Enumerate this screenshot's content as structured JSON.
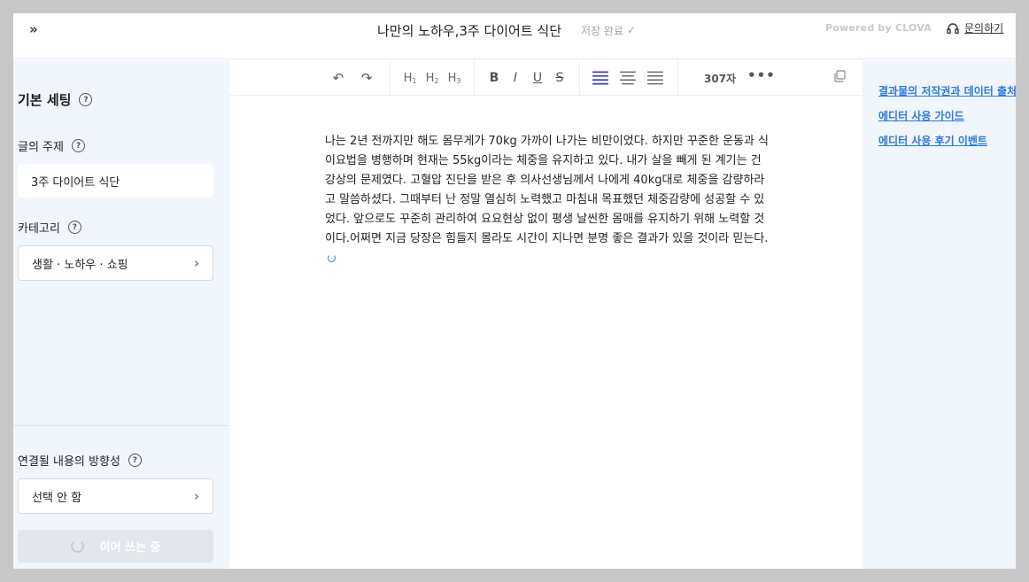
{
  "header": {
    "expand_icon": "double-chevron-right-icon",
    "expand_glyph": "»",
    "title": "나만의 노하우,3주 다이어트 식단",
    "save_status": "저장 완료",
    "check_glyph": "✓",
    "powered_by": "Powered by CLOVA",
    "inquiry_label": "문의하기"
  },
  "sidebar": {
    "section_title": "기본 세팅",
    "help_glyph": "?",
    "topic_label": "글의 주제",
    "topic_value": "3주 다이어트 식단",
    "category_label": "카테고리",
    "category_value": "생활 · 노하우 · 쇼핑",
    "direction_label": "연결될 내용의 방향성",
    "direction_value": "선택 안 함",
    "chevron_glyph": "›",
    "writing_label": "이어 쓰는 중"
  },
  "toolbar": {
    "undo_glyph": "↶",
    "redo_glyph": "↷",
    "h1": "H",
    "h1_sub": "1",
    "h2": "H",
    "h2_sub": "2",
    "h3": "H",
    "h3_sub": "3",
    "bold": "B",
    "italic": "I",
    "underline": "U",
    "strike": "S",
    "char_count": "307자",
    "more_glyph": "•••"
  },
  "editor": {
    "body": "나는 2년 전까지만 해도 몸무게가 70kg 가까이 나가는 비만이었다. 하지만 꾸준한 운동과 식이요법을 병행하며 현재는 55kg이라는 체중을 유지하고 있다. 내가 살을 빼게 된 계기는 건강상의 문제였다. 고혈압 진단을 받은 후 의사선생님께서 나에게 40kg대로 체중을 감량하라고 말씀하셨다. 그때부터 난 정말 열심히 노력했고 마침내 목표했던 체중감량에 성공할 수 있었다. 앞으로도 꾸준히 관리하여 요요현상 없이 평생 날씬한 몸매를 유지하기 위해 노력할 것이다.어쩌면 지금 당장은 힘들지 몰라도 시간이 지나면 분명 좋은 결과가 있을 것이라 믿는다."
  },
  "right_panel": {
    "links": [
      "결과물의 저작권과 데이터 출처",
      "에디터 사용 가이드",
      "에디터 사용 후기 이벤트"
    ]
  },
  "colors": {
    "sidebar_bg": "#f1f5fc",
    "link": "#2a7ae2",
    "accent": "#4a6cf7"
  }
}
